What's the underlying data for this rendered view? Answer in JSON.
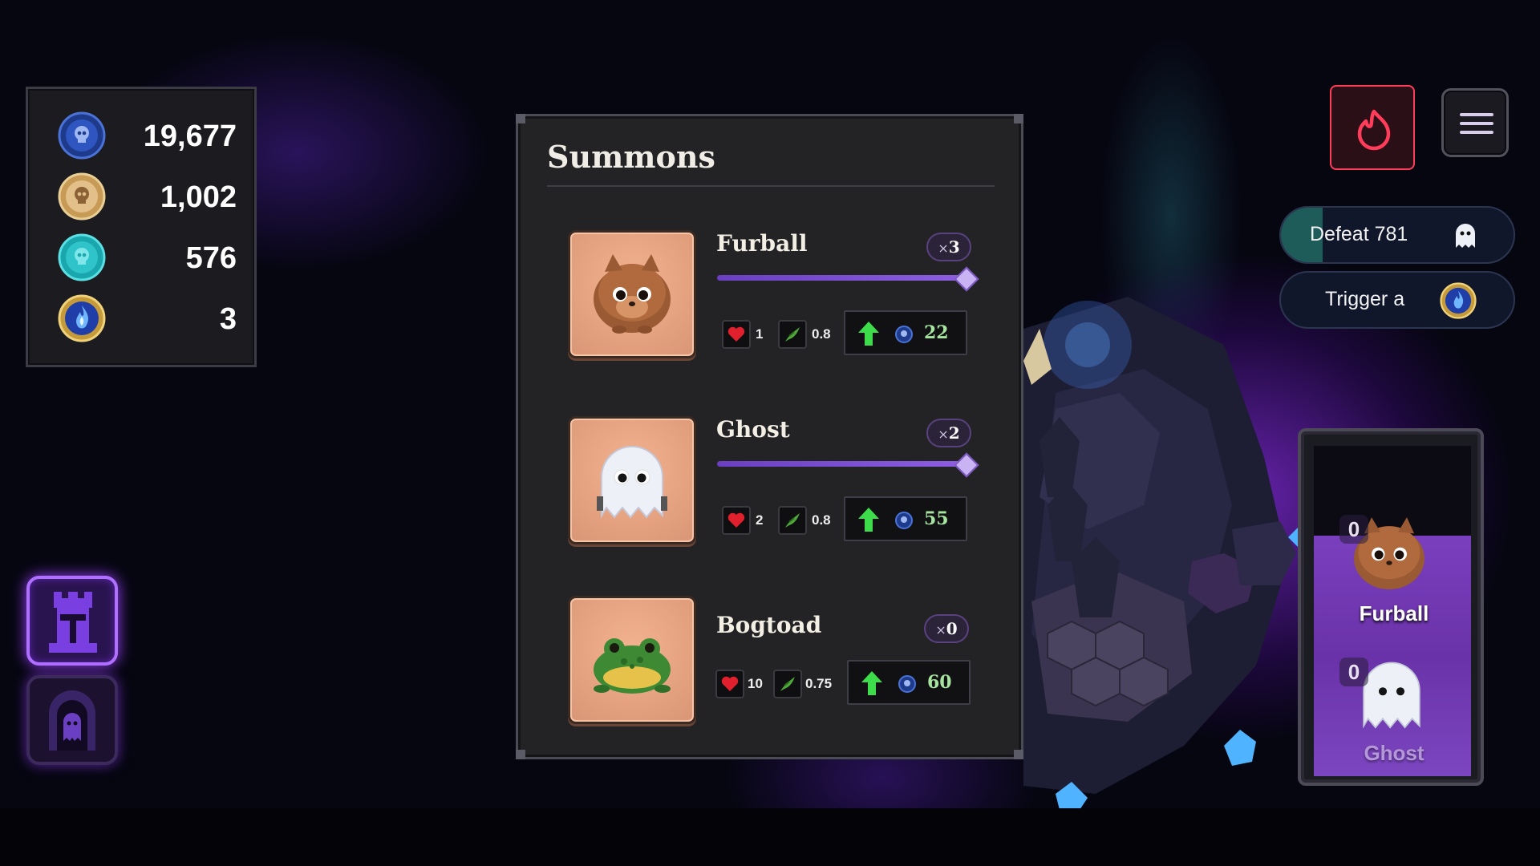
{
  "currencies": [
    {
      "icon": "blue-skull-coin-icon",
      "value": "19,677",
      "color": "#3a5fc8"
    },
    {
      "icon": "gold-skull-coin-icon",
      "value": "1,002",
      "color": "#d8b57a"
    },
    {
      "icon": "teal-skull-coin-icon",
      "value": "576",
      "color": "#31c5c9"
    },
    {
      "icon": "blue-flame-medal-icon",
      "value": "3",
      "color": "#2f5fe0"
    }
  ],
  "side_buttons": [
    {
      "icon": "tower-build-icon",
      "active": true
    },
    {
      "icon": "ghost-summon-gate-icon",
      "active": false
    }
  ],
  "summons_panel": {
    "title": "Summons",
    "units": [
      {
        "name": "Furball",
        "count_prefix": "×",
        "count": "3",
        "slider_level": 1.0,
        "health": "1",
        "speed": "0.8",
        "upgrade_cost": "22",
        "portrait": "furball-portrait"
      },
      {
        "name": "Ghost",
        "count_prefix": "×",
        "count": "2",
        "slider_level": 1.0,
        "health": "2",
        "speed": "0.8",
        "upgrade_cost": "55",
        "portrait": "ghost-portrait"
      },
      {
        "name": "Bogtoad",
        "count_prefix": "×",
        "count": "0",
        "health": "10",
        "speed": "0.75",
        "upgrade_cost": "60",
        "portrait": "bogtoad-portrait"
      }
    ]
  },
  "top_right": {
    "fire_button_icon": "flame-icon",
    "menu_button_icon": "hamburger-menu-icon",
    "fire_color": "#ff3d5a"
  },
  "quests": [
    {
      "text": "Defeat 781",
      "icon": "ghost-icon",
      "progress": 0.18
    },
    {
      "text": "Trigger a",
      "icon": "blue-flame-medal-icon",
      "progress": 0
    }
  ],
  "roster": {
    "units": [
      {
        "name": "Furball",
        "count": "0"
      },
      {
        "name": "Ghost",
        "count": "0"
      }
    ]
  }
}
